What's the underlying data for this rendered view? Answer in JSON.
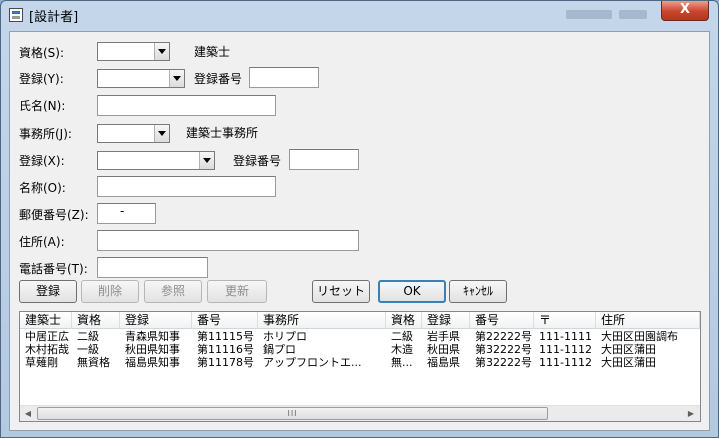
{
  "window": {
    "title": "[設計者]",
    "close_glyph": "X"
  },
  "form": {
    "shikaku_label": "資格(S):",
    "shikaku_value": "",
    "kenchikushi_label": "建築士",
    "toroku1_label": "登録(Y):",
    "toroku1_value": "",
    "toroku_bango1_label": "登録番号",
    "toroku_bango1_value": "",
    "shimei_label": "氏名(N):",
    "shimei_value": "",
    "jimusho_label": "事務所(J):",
    "jimusho_value": "",
    "kenchikushi_jimusho_label": "建築士事務所",
    "toroku2_label": "登録(X):",
    "toroku2_value": "",
    "toroku_bango2_label": "登録番号",
    "toroku_bango2_value": "",
    "meisho_label": "名称(O):",
    "meisho_value": "",
    "yubin_label": "郵便番号(Z):",
    "yubin_value": "-",
    "jusho_label": "住所(A):",
    "jusho_value": "",
    "denwa_label": "電話番号(T):",
    "denwa_value": ""
  },
  "buttons": {
    "register": "登録",
    "delete": "削除",
    "refer": "参照",
    "update": "更新",
    "reset": "リセット",
    "ok": "OK",
    "cancel": "ｷｬﾝｾﾙ"
  },
  "list": {
    "columns": [
      "建築士",
      "資格",
      "登録",
      "番号",
      "事務所",
      "資格",
      "登録",
      "番号",
      "〒",
      "住所"
    ],
    "rows": [
      [
        "中居正広",
        "二級",
        "青森県知事",
        "第11115号",
        "ホリプロ",
        "二級",
        "岩手県",
        "第22222号",
        "111-1111",
        "大田区田園調布"
      ],
      [
        "木村拓哉",
        "一級",
        "秋田県知事",
        "第11116号",
        "鍋プロ",
        "木造",
        "秋田県",
        "第32222号",
        "111-1112",
        "大田区蒲田"
      ],
      [
        "草薙剛",
        "無資格",
        "福島県知事",
        "第11178号",
        "アップフロントエ...",
        "無...",
        "福島県",
        "第32222号",
        "111-1112",
        "大田区蒲田"
      ]
    ],
    "scroll_grip": "III"
  }
}
